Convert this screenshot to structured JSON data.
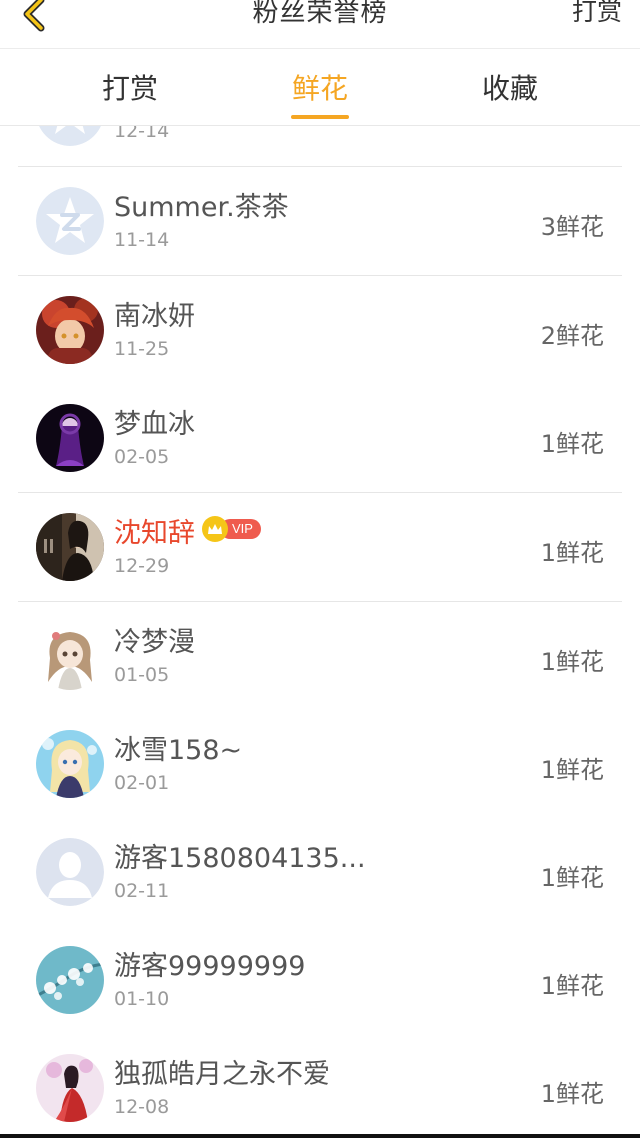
{
  "header": {
    "title": "粉丝荣誉榜",
    "action_label": "打赏"
  },
  "tabs": [
    {
      "label": "打赏",
      "active": false
    },
    {
      "label": "鲜花",
      "active": true
    },
    {
      "label": "收藏",
      "active": false
    }
  ],
  "accent_color": "#f5a623",
  "vip_name_color": "#e8472c",
  "list": [
    {
      "name": "",
      "date": "12-14",
      "count": "",
      "avatar": "default-qq-avatar"
    },
    {
      "name": "Summer.茶茶",
      "date": "11-14",
      "count": "3鲜花",
      "avatar": "default-qq-avatar"
    },
    {
      "name": "南冰妍",
      "date": "11-25",
      "count": "2鲜花",
      "avatar": "anime-girl-red-avatar"
    },
    {
      "name": "梦血冰",
      "date": "02-05",
      "count": "1鲜花",
      "avatar": "dark-purple-figure-avatar"
    },
    {
      "name": "沈知辞",
      "date": "12-29",
      "count": "1鲜花",
      "avatar": "photo-avatar",
      "vip": true,
      "vip_label": "VIP"
    },
    {
      "name": "冷梦漫",
      "date": "01-05",
      "count": "1鲜花",
      "avatar": "chibi-girl-avatar"
    },
    {
      "name": "冰雪158~",
      "date": "02-01",
      "count": "1鲜花",
      "avatar": "anime-blonde-avatar"
    },
    {
      "name": "游客1580804135...",
      "date": "02-11",
      "count": "1鲜花",
      "avatar": "default-user-avatar"
    },
    {
      "name": "游客99999999",
      "date": "01-10",
      "count": "1鲜花",
      "avatar": "snow-branch-avatar"
    },
    {
      "name": "独孤皓月之永不爱",
      "date": "12-08",
      "count": "1鲜花",
      "avatar": "red-dress-avatar"
    }
  ]
}
